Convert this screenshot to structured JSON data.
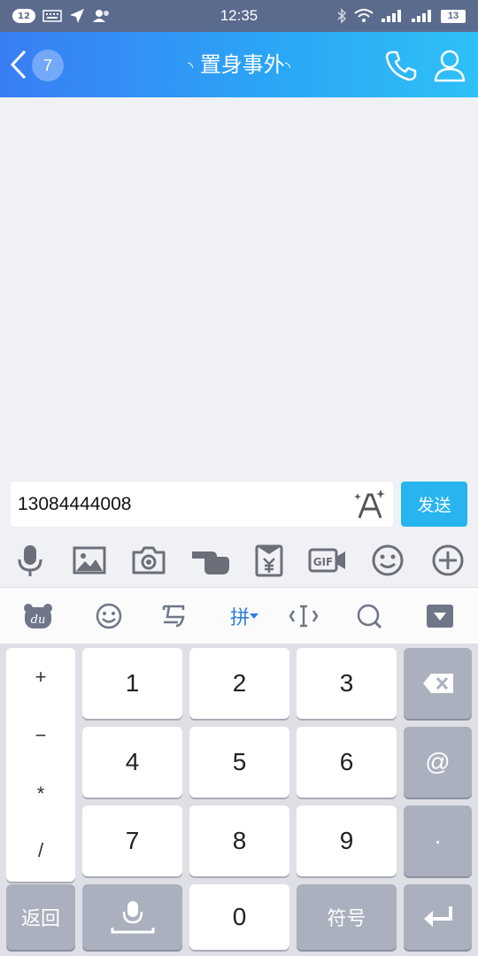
{
  "status_bar": {
    "notification_count": "12",
    "time": "12:35",
    "battery": "13"
  },
  "header": {
    "back_count": "7",
    "title": "置身事外",
    "title_deco_left": "◝",
    "title_deco_right": "◝"
  },
  "input": {
    "value": "13084444008",
    "send_label": "发送"
  },
  "ime": {
    "mode_label": "拼"
  },
  "keyboard": {
    "symbols": [
      "+",
      "−",
      "*",
      "/"
    ],
    "digits": [
      "1",
      "2",
      "3",
      "4",
      "5",
      "6",
      "7",
      "8",
      "9",
      "0"
    ],
    "dot": "·",
    "at": "@",
    "back_label": "返回",
    "symbol_label": "符号"
  },
  "icons": [
    "notification-badge",
    "keyboard-icon",
    "location-icon",
    "contacts-icon",
    "bluetooth-icon",
    "wifi-icon",
    "signal-icon",
    "back-chevron-icon",
    "phone-icon",
    "user-icon",
    "font-style-icon",
    "microphone-icon",
    "image-icon",
    "camera-icon",
    "poke-hand-icon",
    "red-packet-icon",
    "gif-icon",
    "emoji-icon",
    "plus-icon",
    "du-logo-icon",
    "ime-emoji-icon",
    "handwrite-icon",
    "pinyin-mode",
    "cursor-icon",
    "ime-search-icon",
    "hide-keyboard-icon",
    "backspace-icon",
    "voice-icon",
    "enter-icon"
  ],
  "colors": {
    "header_start": "#3a7df5",
    "header_end": "#2fc0f8",
    "send_button": "#27b4ef",
    "keyboard_bg": "#dee0e6"
  }
}
